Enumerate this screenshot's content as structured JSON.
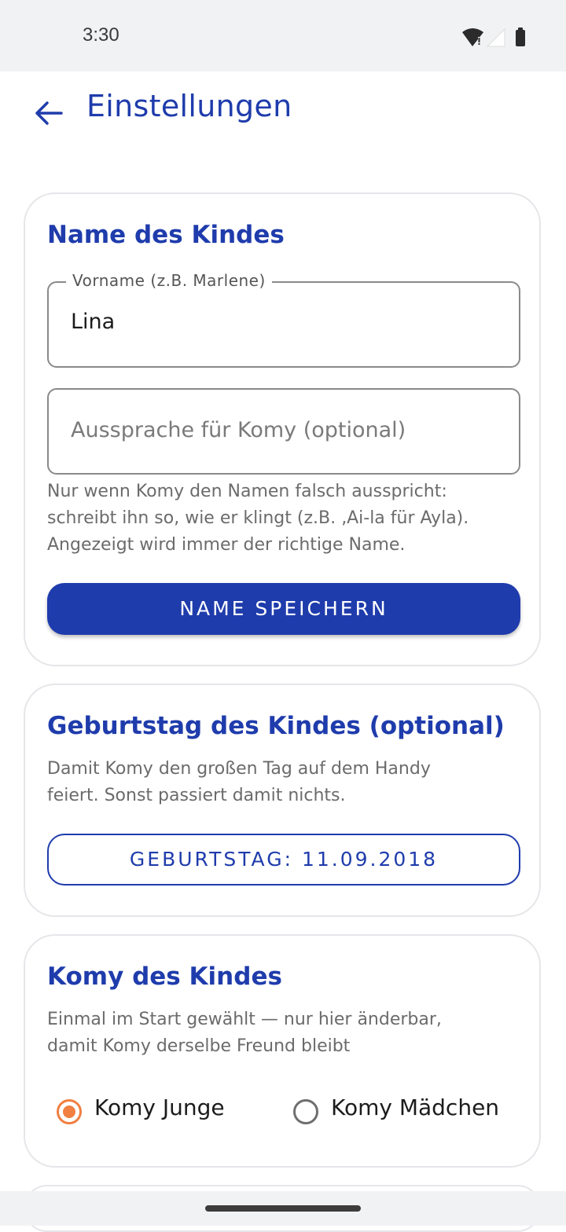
{
  "status_bar": {
    "time": "3:30",
    "icons": [
      "wifi-icon",
      "signal-icon",
      "battery-icon"
    ]
  },
  "app_bar": {
    "back_icon": "arrow-back-icon",
    "title": "Einstellungen"
  },
  "name_card": {
    "title": "Name des Kindes",
    "first_name_field": {
      "label": "Vorname (z.B. Marlene)",
      "value": "Lina"
    },
    "pronunciation_field": {
      "placeholder": "Aussprache für Komy (optional)",
      "value": ""
    },
    "help_lines": [
      "Nur wenn Komy den Namen falsch ausspricht:",
      "schreibt ihn so, wie er klingt (z.B. ‚Ai-la für Ayla).",
      "Angezeigt wird immer der richtige Name."
    ],
    "save_button_label": "NAME SPEICHERN"
  },
  "birthday_card": {
    "title": "Geburtstag des Kindes (optional)",
    "desc_lines": [
      "Damit Komy den großen Tag auf dem Handy",
      "feiert. Sonst passiert damit nichts."
    ],
    "birthday_button_label": "GEBURTSTAG: 11.09.2018"
  },
  "komy_card": {
    "title": "Komy des Kindes",
    "desc_lines": [
      "Einmal im Start gewählt — nur hier änderbar,",
      "damit Komy derselbe Freund bleibt"
    ],
    "options": [
      {
        "label": "Komy Junge",
        "selected": true
      },
      {
        "label": "Komy Mädchen",
        "selected": false
      }
    ]
  },
  "colors": {
    "primary": "#1f3cac",
    "accent_radio": "#f07f41",
    "card_border": "#e6e6ea",
    "system_bar": "#f1f2f4"
  }
}
